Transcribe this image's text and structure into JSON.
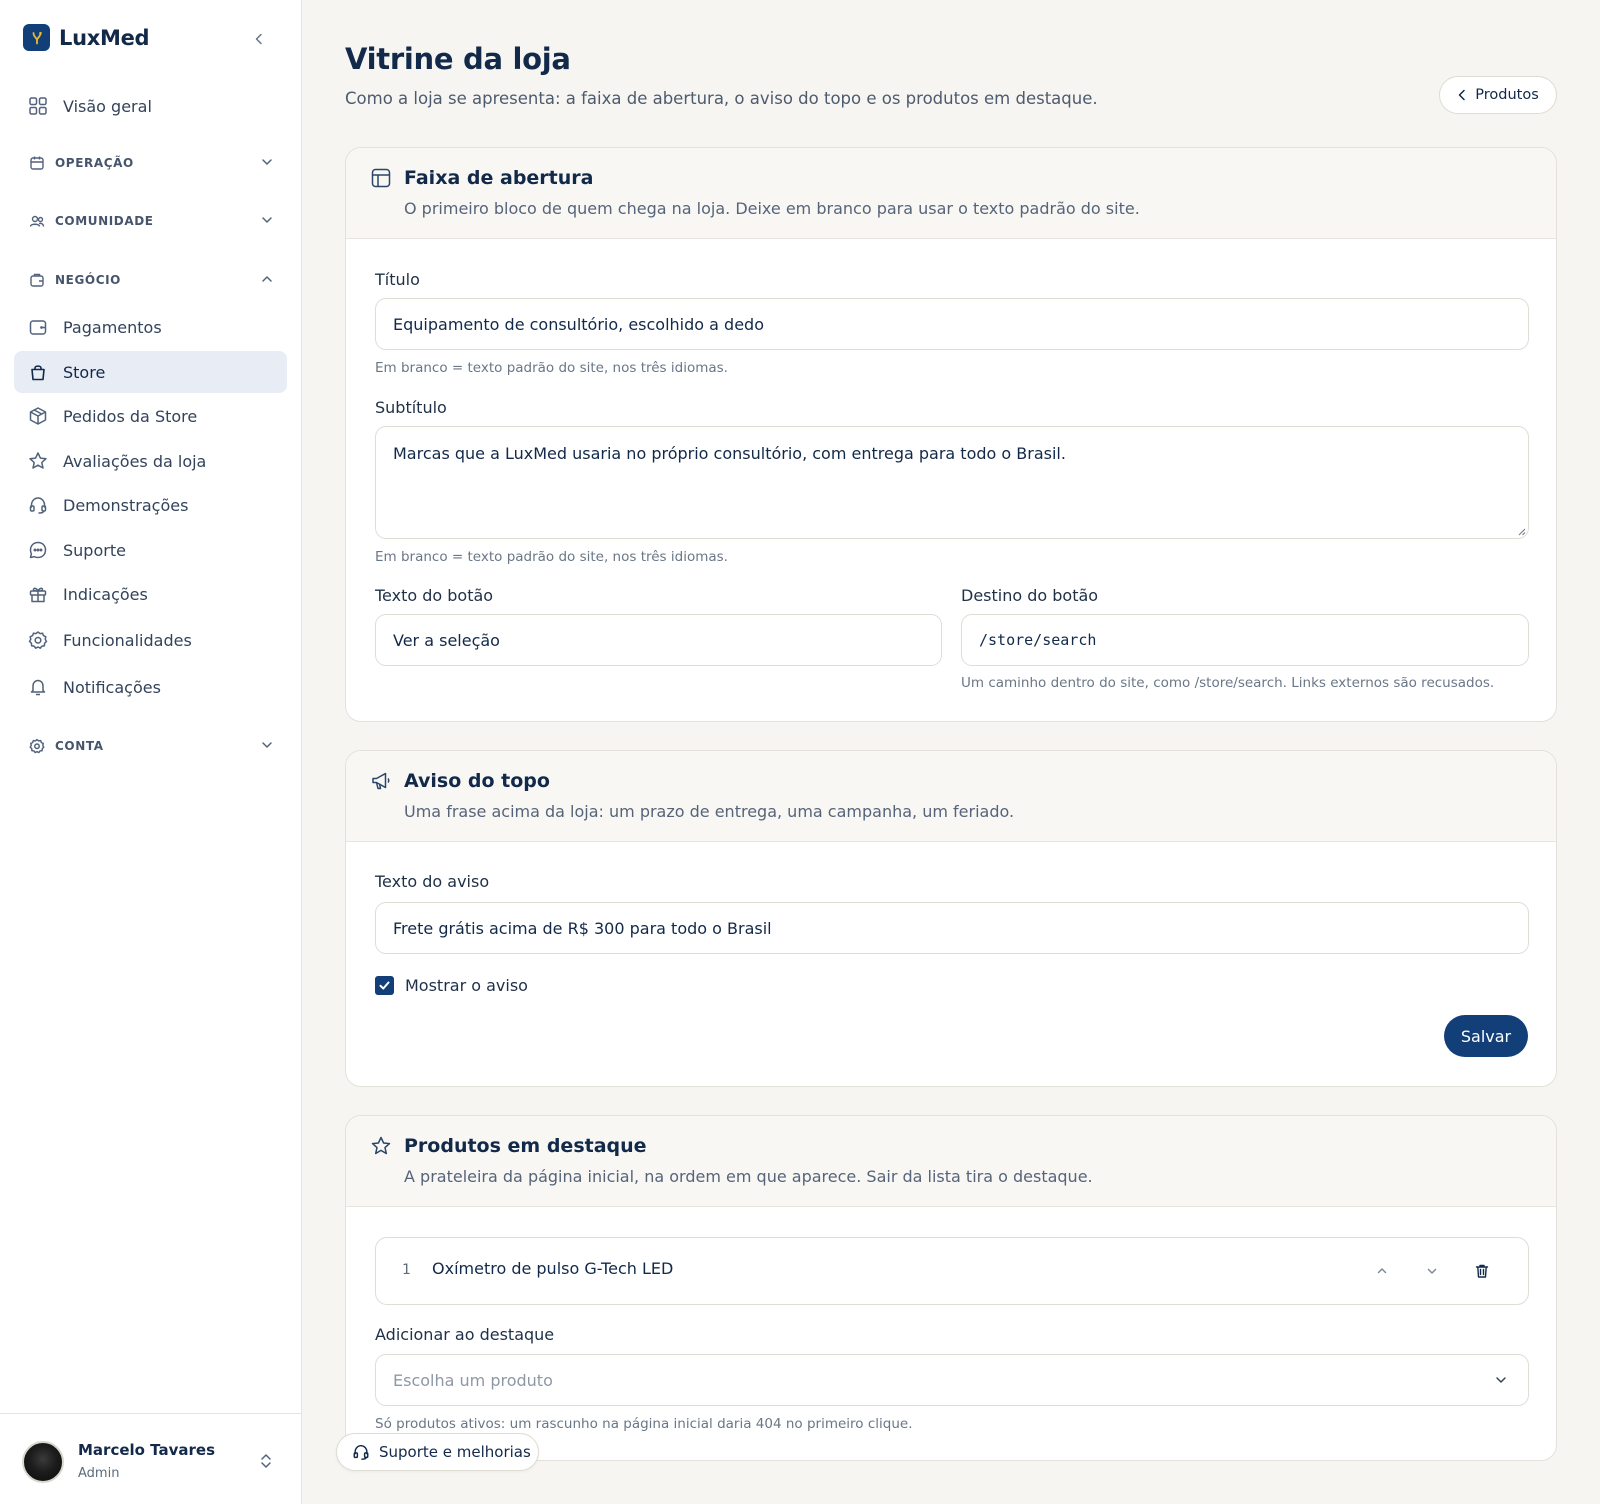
{
  "brand": {
    "name": "LuxMed"
  },
  "sidebar": {
    "overview": "Visão geral",
    "sections": {
      "operacao": "OPERAÇÃO",
      "comunidade": "COMUNIDADE",
      "negocio": "NEGÓCIO",
      "conta": "CONTA"
    },
    "items": [
      {
        "label": "Pagamentos",
        "icon": "wallet-icon"
      },
      {
        "label": "Store",
        "icon": "shopping-bag-icon",
        "active": true
      },
      {
        "label": "Pedidos da Store",
        "icon": "package-icon"
      },
      {
        "label": "Avaliações da loja",
        "icon": "star-icon"
      },
      {
        "label": "Demonstrações",
        "icon": "headset-icon"
      },
      {
        "label": "Suporte",
        "icon": "chat-bubble-icon"
      },
      {
        "label": "Indicações",
        "icon": "gift-icon"
      },
      {
        "label": "Funcionalidades",
        "icon": "gear-icon"
      },
      {
        "label": "Notificações",
        "icon": "bell-icon"
      }
    ]
  },
  "user": {
    "name": "Marcelo Tavares",
    "role": "Admin"
  },
  "page": {
    "title": "Vitrine da loja",
    "subtitle": "Como a loja se apresenta: a faixa de abertura, o aviso do topo e os produtos em destaque.",
    "back_label": "Produtos"
  },
  "hero": {
    "title": "Faixa de abertura",
    "desc": "O primeiro bloco de quem chega na loja. Deixe em branco para usar o texto padrão do site.",
    "title_label": "Título",
    "title_value": "Equipamento de consultório, escolhido a dedo",
    "title_hint": "Em branco = texto padrão do site, nos três idiomas.",
    "subtitle_label": "Subtítulo",
    "subtitle_value": "Marcas que a LuxMed usaria no próprio consultório, com entrega para todo o Brasil.",
    "subtitle_hint": "Em branco = texto padrão do site, nos três idiomas.",
    "button_text_label": "Texto do botão",
    "button_text_value": "Ver a seleção",
    "button_dest_label": "Destino do botão",
    "button_dest_value": "/store/search",
    "button_dest_hint": "Um caminho dentro do site, como /store/search. Links externos são recusados."
  },
  "notice": {
    "title": "Aviso do topo",
    "desc": "Uma frase acima da loja: um prazo de entrega, uma campanha, um feriado.",
    "text_label": "Texto do aviso",
    "text_value": "Frete grátis acima de R$ 300 para todo o Brasil",
    "show_label": "Mostrar o aviso",
    "show_checked": true,
    "save_label": "Salvar"
  },
  "featured": {
    "title": "Produtos em destaque",
    "desc": "A prateleira da página inicial, na ordem em que aparece. Sair da lista tira o destaque.",
    "items": [
      {
        "index": "1",
        "name": "Oxímetro de pulso G-Tech LED"
      }
    ],
    "add_label": "Adicionar ao destaque",
    "add_placeholder": "Escolha um produto",
    "add_hint": "Só produtos ativos: um rascunho na página inicial daria 404 no primeiro clique."
  },
  "support_button": "Suporte e melhorias",
  "colors": {
    "primary": "#123f77",
    "page_background": "#f6f5f1",
    "active_nav_background": "#e8edf5",
    "text_dark": "#12294a",
    "logo_accent": "#e8b931"
  }
}
